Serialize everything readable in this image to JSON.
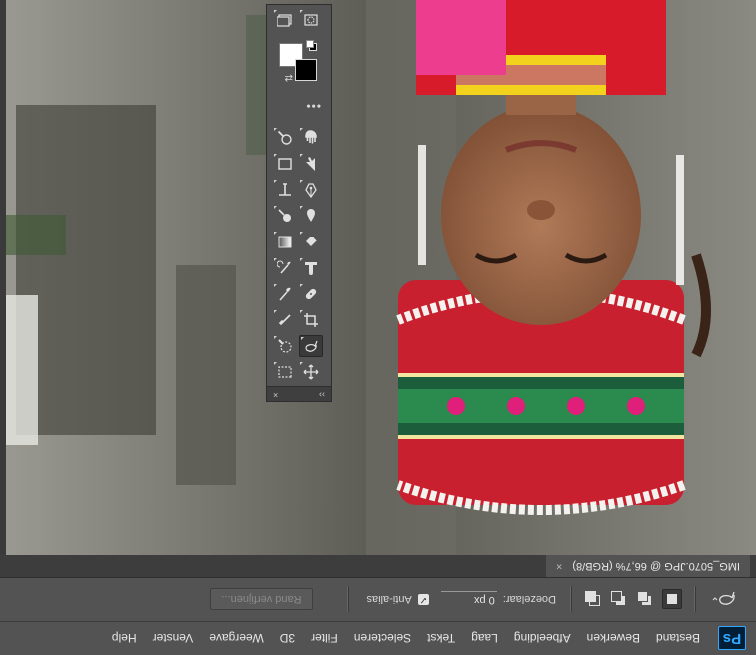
{
  "app": {
    "logo_text": "Ps"
  },
  "menu": [
    "Bestand",
    "Bewerken",
    "Afbeelding",
    "Laag",
    "Tekst",
    "Selecteren",
    "Filter",
    "3D",
    "Weergave",
    "Venster",
    "Help"
  ],
  "options_bar": {
    "feather_label": "Doezelaar:",
    "feather_value": "0 px",
    "antialias_label": "Anti-alias",
    "antialias_checked": true,
    "refine_edge_label": "Rand verfijnen..."
  },
  "document_tab": {
    "title": "IMG_5070.JPG @ 66,7% (RGB/8)",
    "close_glyph": "×"
  },
  "tools_panel": {
    "collapse_glyph": "››",
    "close_glyph": "×",
    "more_glyph": "•••",
    "swap_glyph": "⇄",
    "foreground_color": "#000000",
    "background_color": "#ffffff",
    "tools": [
      {
        "name": "move-icon",
        "active": false
      },
      {
        "name": "rectangular-marquee-icon",
        "active": false
      },
      {
        "name": "lasso-icon",
        "active": true
      },
      {
        "name": "quick-selection-icon",
        "active": false
      },
      {
        "name": "crop-icon",
        "active": false
      },
      {
        "name": "eyedropper-icon",
        "active": false
      },
      {
        "name": "spot-healing-icon",
        "active": false
      },
      {
        "name": "brush-icon",
        "active": false
      },
      {
        "name": "clone-stamp-icon",
        "active": false
      },
      {
        "name": "history-brush-icon",
        "active": false
      },
      {
        "name": "eraser-icon",
        "active": false
      },
      {
        "name": "gradient-icon",
        "active": false
      },
      {
        "name": "blur-icon",
        "active": false
      },
      {
        "name": "dodge-icon",
        "active": false
      },
      {
        "name": "pen-icon",
        "active": false
      },
      {
        "name": "type-icon",
        "active": false
      },
      {
        "name": "path-selection-icon",
        "active": false
      },
      {
        "name": "rectangle-shape-icon",
        "active": false
      },
      {
        "name": "hand-icon",
        "active": false
      },
      {
        "name": "zoom-icon",
        "active": false
      },
      {
        "name": "edit-toolbar-icon",
        "active": false
      },
      {
        "name": "quick-mask-icon",
        "active": false
      },
      {
        "name": "screen-mode-icon",
        "active": false
      }
    ]
  },
  "colors": {
    "ui_panel": "#535353",
    "ui_dark": "#3d3d3d",
    "ps_blue": "#31a8ff",
    "ps_navy": "#001e36"
  }
}
